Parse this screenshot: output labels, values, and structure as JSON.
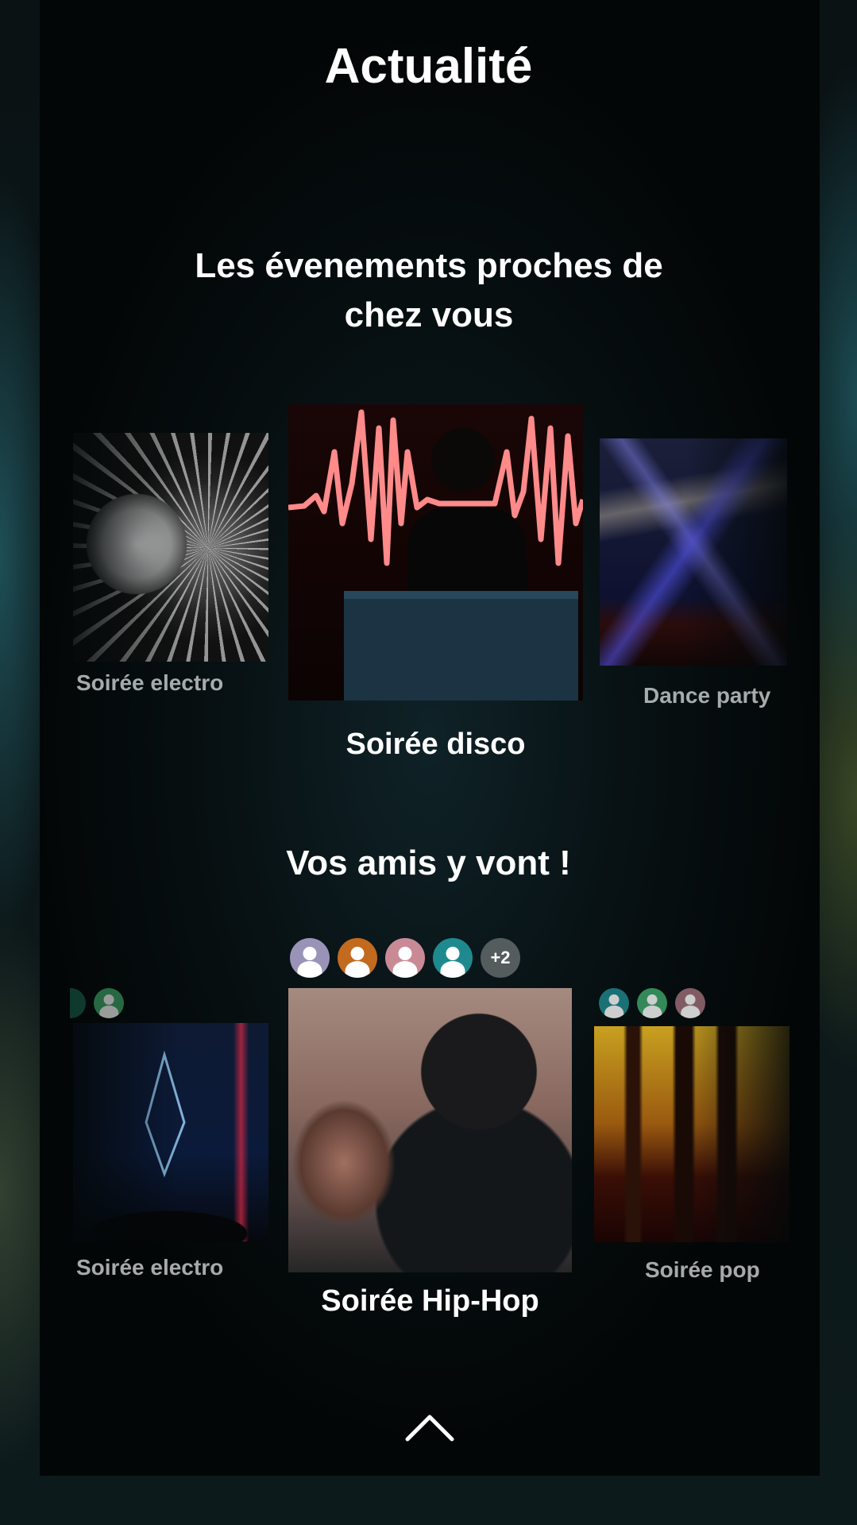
{
  "header": {
    "title": "Actualité"
  },
  "nearby": {
    "title": "Les évenements proches de chez vous",
    "events": [
      {
        "label": "Soirée electro"
      },
      {
        "label": "Soirée disco"
      },
      {
        "label": "Dance party"
      }
    ]
  },
  "friends": {
    "title": "Vos amis y vont !",
    "events": [
      {
        "label": "Soirée electro"
      },
      {
        "label": "Soirée Hip-Hop",
        "more_count": "+2"
      },
      {
        "label": "Soirée pop"
      }
    ]
  },
  "colors": {
    "avatar_lavender": "#9a93b8",
    "avatar_orange": "#c26a1e",
    "avatar_pink": "#c98a96",
    "avatar_teal": "#1e8a8f",
    "avatar_green": "#3fa86a",
    "avatar_rose": "#a0707a"
  },
  "icons": {
    "scroll_up": "chevron-up-icon",
    "user": "user-avatar-icon"
  }
}
